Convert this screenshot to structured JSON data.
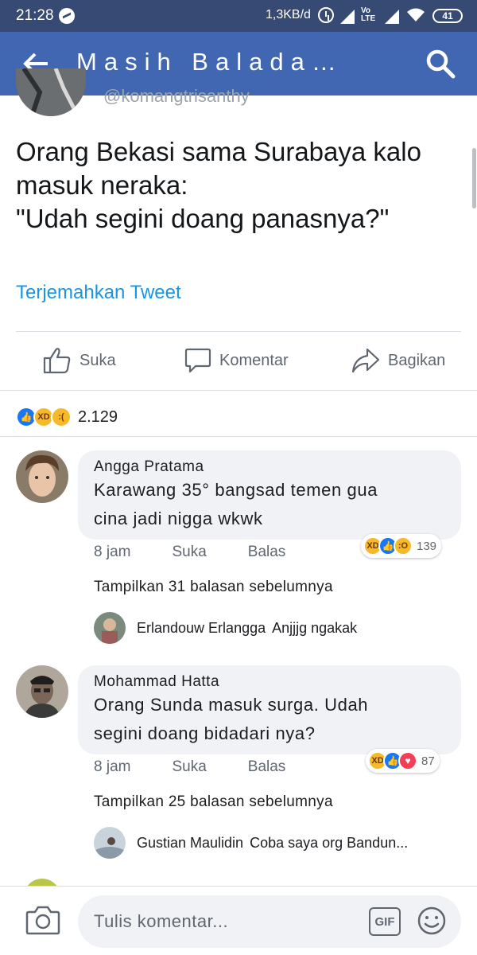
{
  "status_bar": {
    "time": "21:28",
    "network_speed": "1,3KB/d",
    "volte": "VoLTE",
    "battery": "41"
  },
  "app_bar": {
    "title": "Masih Balada…",
    "back_icon": "arrow-left-icon",
    "search_icon": "search-icon"
  },
  "tweet": {
    "handle": "@komangtrisanthy",
    "lines": [
      "Orang Bekasi sama Surabaya kalo",
      "masuk neraka:",
      "\"Udah segini doang panasnya?\""
    ],
    "translate_label": "Terjemahkan Tweet"
  },
  "actions": {
    "like": "Suka",
    "comment": "Komentar",
    "share": "Bagikan"
  },
  "reactions": {
    "icons": [
      "like",
      "haha",
      "sad"
    ],
    "count": "2.129"
  },
  "comments": [
    {
      "author": "Angga Pratama",
      "text_lines": [
        "Karawang 35° bangsad temen gua",
        "cina jadi nigga wkwk"
      ],
      "time": "8 jam",
      "like_label": "Suka",
      "reply_label": "Balas",
      "reactions": [
        "haha",
        "like",
        "wow"
      ],
      "reaction_count": "139",
      "more_replies": "Tampilkan 31 balasan sebelumnya",
      "reply_preview": {
        "author": "Erlandouw Erlangga",
        "text": "Anjjjg ngakak"
      }
    },
    {
      "author": "Mohammad Hatta",
      "text_lines": [
        "Orang Sunda masuk surga. Udah",
        "segini doang bidadari nya?"
      ],
      "time": "8 jam",
      "like_label": "Suka",
      "reply_label": "Balas",
      "reactions": [
        "haha",
        "like",
        "love"
      ],
      "reaction_count": "87",
      "more_replies": "Tampilkan 25 balasan sebelumnya",
      "reply_preview": {
        "author": "Gustian Maulidin",
        "text": "Coba saya org Bandun..."
      }
    }
  ],
  "composer": {
    "placeholder": "Tulis komentar...",
    "gif_label": "GIF",
    "camera_icon": "camera-icon",
    "emoji_icon": "smiley-icon"
  },
  "colors": {
    "status_bar": "#374a74",
    "app_bar": "#4267b2",
    "link": "#1b95e0",
    "like_blue": "#1877f2",
    "haha_yellow": "#f7b928",
    "love_red": "#f33e58"
  }
}
